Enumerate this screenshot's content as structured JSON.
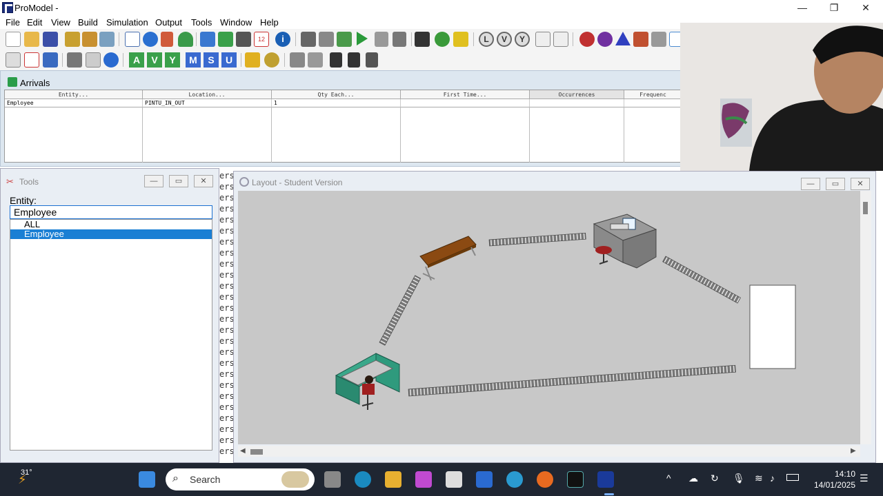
{
  "window": {
    "title": "ProModel -",
    "controls": {
      "minimize": "—",
      "maximize": "❐",
      "close": "✕"
    }
  },
  "menu": [
    "File",
    "Edit",
    "View",
    "Build",
    "Simulation",
    "Output",
    "Tools",
    "Window",
    "Help"
  ],
  "toolbar2_letters": [
    "A",
    "V",
    "Y",
    "M",
    "S",
    "U"
  ],
  "toolbar1_circles": [
    "L",
    "V",
    "Y"
  ],
  "arrivals": {
    "title": "Arrivals",
    "columns": [
      "Entity...",
      "Location...",
      "Qty Each...",
      "First Time...",
      "Occurrences",
      "Frequenc"
    ],
    "rows": [
      [
        "Employee",
        "PINTU_IN_OUT",
        "1",
        "",
        "",
        ""
      ]
    ]
  },
  "tools": {
    "title": "Tools",
    "entity_label": "Entity:",
    "entity_value": "Employee",
    "list": [
      "ALL",
      "Employee"
    ],
    "selected_index": 1
  },
  "stripe_text": "ersi",
  "layout": {
    "title": "Layout - Student Version"
  },
  "taskbar": {
    "weather_temp": "31°",
    "search_placeholder": "Search",
    "time": "14:10",
    "date": "14/01/2025"
  },
  "colors": {
    "accent_blue": "#1a7fd4",
    "taskbar_bg": "#1f2632",
    "canvas_bg": "#c8c8c8",
    "panel_bg": "#e9eef4"
  }
}
